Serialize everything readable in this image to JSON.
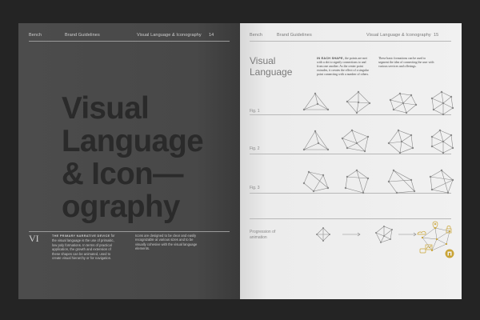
{
  "left_page": {
    "header_brand": "Bench",
    "header_section": "Brand Guidelines",
    "header_chapter": "Visual Language & Iconography",
    "page_number": "14",
    "title_lines": [
      "Visual",
      "Language",
      "& Icon—",
      "ography"
    ],
    "chapter_numeral": "VI",
    "intro_lead": "THE PRIMARY NARRATIVE DEVICE",
    "intro_text": "for the visual language is the use of primaitic, low poly formations. In terms of practical application, the growth and extension of these shapes can be animated, used to create visual hierarchy or for navigation.",
    "intro_text_2": "Icons are designed to be clear and easily recognizable at various sizes and to be visually cohesive with the visual language elements."
  },
  "right_page": {
    "header_brand": "Bench",
    "header_section": "Brand Guidelines",
    "header_chapter": "Visual Language & Iconography",
    "page_number": "15",
    "heading_line1": "Visual",
    "heading_line2": "Language",
    "body_lead": "IN EACH SHAPE,",
    "body_text": "the points are met with a dot to signify connections to and from one another. As the center point extrudes, it creates the effect of a singular point connecting with a number of others.",
    "body_text_2": "These basic formations can be used to segment the idea of connecting the user with various services and offerings.",
    "fig_labels": [
      "Fig. 1",
      "Fig. 2",
      "Fig. 3"
    ],
    "progression_label": "Progression of animation",
    "colors": {
      "accent": "#c9a436",
      "line": "#8a8a8a"
    }
  }
}
